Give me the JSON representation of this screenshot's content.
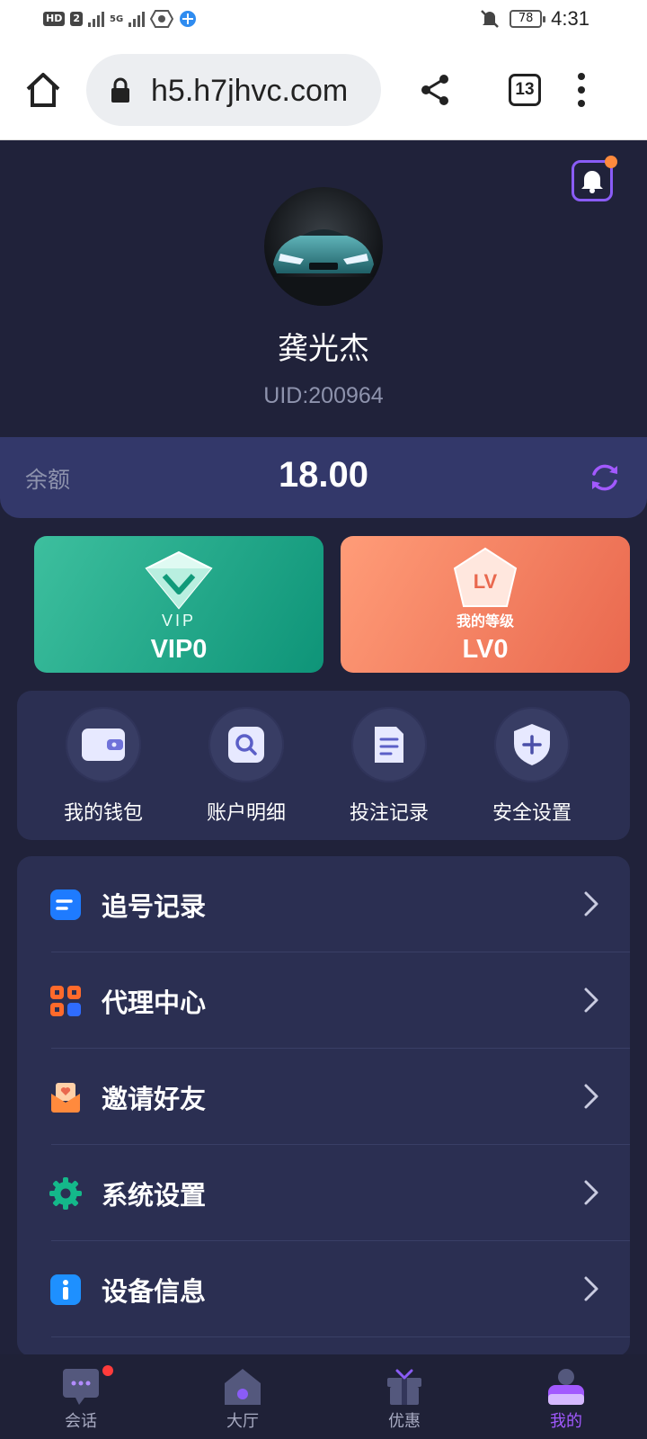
{
  "status_bar": {
    "badges": [
      "HD",
      "2"
    ],
    "network": "5G",
    "battery": "78",
    "time": "4:31"
  },
  "browser": {
    "url": "h5.h7jhvc.com",
    "tab_count": "13"
  },
  "profile": {
    "name": "龚光杰",
    "uid": "UID:200964"
  },
  "balance": {
    "label": "余额",
    "value": "18.00"
  },
  "cards": {
    "vip": {
      "emblem_text": "VIP",
      "value": "VIP0"
    },
    "level": {
      "emblem_text": "LV",
      "caption": "我的等级",
      "value": "LV0"
    }
  },
  "quick_actions": [
    {
      "label": "我的钱包",
      "icon": "wallet-icon"
    },
    {
      "label": "账户明细",
      "icon": "search-doc-icon"
    },
    {
      "label": "投注记录",
      "icon": "document-icon"
    },
    {
      "label": "安全设置",
      "icon": "shield-icon"
    }
  ],
  "menu": [
    {
      "label": "追号记录",
      "icon": "list-icon",
      "color": "#1e7bff"
    },
    {
      "label": "代理中心",
      "icon": "agent-grid-icon",
      "color": "#ff6a2b"
    },
    {
      "label": "邀请好友",
      "icon": "invite-icon",
      "color": "#ff8a3d"
    },
    {
      "label": "系统设置",
      "icon": "gear-icon",
      "color": "#14b88a"
    },
    {
      "label": "设备信息",
      "icon": "info-icon",
      "color": "#1e90ff"
    }
  ],
  "bottom_nav": [
    {
      "label": "会话",
      "icon": "chat-icon",
      "active": false
    },
    {
      "label": "大厅",
      "icon": "home-icon",
      "active": false
    },
    {
      "label": "优惠",
      "icon": "gift-icon",
      "active": false
    },
    {
      "label": "我的",
      "icon": "profile-icon",
      "active": true
    }
  ],
  "colors": {
    "background": "#20223a",
    "panel": "#2b2f52",
    "accent": "#a259ff",
    "vip_green": "#0e9478",
    "level_orange": "#e9684e"
  }
}
